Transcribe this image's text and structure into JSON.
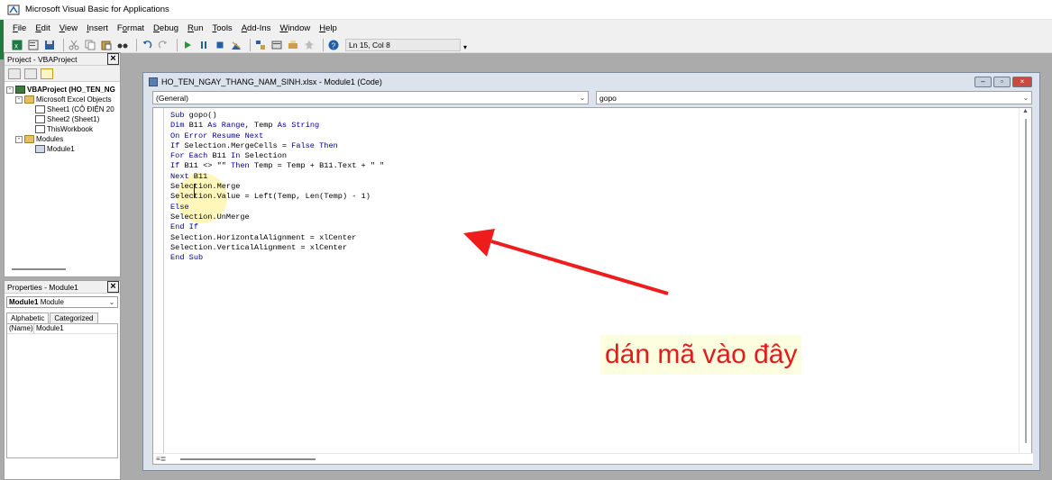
{
  "window": {
    "title": "Microsoft Visual Basic for Applications"
  },
  "menu": [
    {
      "pre": "",
      "u": "F",
      "post": "ile"
    },
    {
      "pre": "",
      "u": "E",
      "post": "dit"
    },
    {
      "pre": "",
      "u": "V",
      "post": "iew"
    },
    {
      "pre": "",
      "u": "I",
      "post": "nsert"
    },
    {
      "pre": "F",
      "u": "o",
      "post": "rmat"
    },
    {
      "pre": "",
      "u": "D",
      "post": "ebug"
    },
    {
      "pre": "",
      "u": "R",
      "post": "un"
    },
    {
      "pre": "",
      "u": "T",
      "post": "ools"
    },
    {
      "pre": "",
      "u": "A",
      "post": "dd-Ins"
    },
    {
      "pre": "",
      "u": "W",
      "post": "indow"
    },
    {
      "pre": "",
      "u": "H",
      "post": "elp"
    }
  ],
  "toolbar": {
    "position": "Ln 15, Col 8"
  },
  "project_pane": {
    "title": "Project - VBAProject",
    "tree": {
      "root": "VBAProject (HO_TEN_NG",
      "excel_objects": "Microsoft Excel Objects",
      "sheet1": "Sheet1 (CỘ ĐIỆN 20",
      "sheet2": "Sheet2 (Sheet1)",
      "workbook": "ThisWorkbook",
      "modules": "Modules",
      "module1": "Module1"
    }
  },
  "properties_pane": {
    "title": "Properties - Module1",
    "object_name": "Module1",
    "object_type": "Module",
    "tabs": [
      "Alphabetic",
      "Categorized"
    ],
    "rows": [
      {
        "key": "(Name)",
        "value": "Module1"
      }
    ]
  },
  "code_window": {
    "title": "HO_TEN_NGAY_THANG_NAM_SINH.xlsx - Module1 (Code)",
    "object_combo": "(General)",
    "proc_combo": "gopo",
    "lines": [
      "Sub gopo()",
      "Dim B11 As Range, Temp As String",
      "On Error Resume Next",
      "If Selection.MergeCells = False Then",
      "For Each B11 In Selection",
      "If B11 <> \"\" Then Temp = Temp + B11.Text + \" \"",
      "Next B11",
      "Selection.Merge",
      "Selection.Value = Left(Temp, Len(Temp) - 1)",
      "Else",
      "Selection.UnMerge",
      "End If",
      "Selection.HorizontalAlignment = xlCenter",
      "Selection.VerticalAlignment = xlCenter",
      "End Sub"
    ]
  },
  "annotation": {
    "text": "dán mã vào đây",
    "color": "#e01c1c"
  }
}
